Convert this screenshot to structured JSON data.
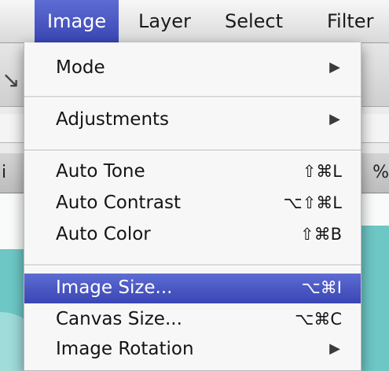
{
  "menubar": {
    "items": [
      {
        "label": "Image"
      },
      {
        "label": "Layer"
      },
      {
        "label": "Select"
      },
      {
        "label": "Filter"
      }
    ]
  },
  "background": {
    "tab_partial": "i",
    "zoom_partial": "%"
  },
  "menu": {
    "items": [
      {
        "label": "Mode",
        "shortcut": ""
      },
      {
        "label": "Adjustments",
        "shortcut": ""
      },
      {
        "label": "Auto Tone",
        "shortcut": "⇧⌘L"
      },
      {
        "label": "Auto Contrast",
        "shortcut": "⌥⇧⌘L"
      },
      {
        "label": "Auto Color",
        "shortcut": "⇧⌘B"
      },
      {
        "label": "Image Size...",
        "shortcut": "⌥⌘I"
      },
      {
        "label": "Canvas Size...",
        "shortcut": "⌥⌘C"
      },
      {
        "label": "Image Rotation",
        "shortcut": ""
      }
    ]
  },
  "colors": {
    "highlight": "#4a58c8",
    "canvas_teal": "#6dc7c5"
  }
}
